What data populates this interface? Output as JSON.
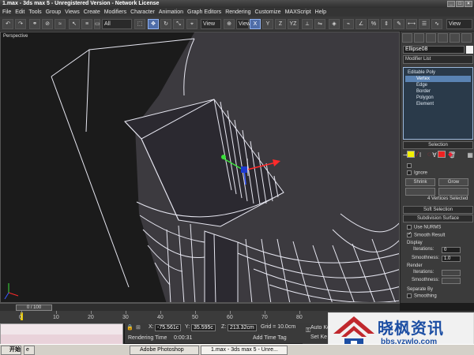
{
  "window": {
    "title": "1.max - 3ds max 5 - Unregistered Version - Network License",
    "controls": [
      "_",
      "□",
      "×"
    ]
  },
  "menu": [
    "File",
    "Edit",
    "Tools",
    "Group",
    "Views",
    "Create",
    "Modifiers",
    "Character",
    "Animation",
    "Graph Editors",
    "Rendering",
    "Customize",
    "MAXScript",
    "Help"
  ],
  "toolbar": {
    "selection_filter": "All",
    "refcoord_1": "View",
    "refcoord_2": "View",
    "axis_x": "X",
    "axis_y": "Y",
    "axis_z": "Z",
    "axis_yz": "YZ",
    "named_sets": "View"
  },
  "viewport": {
    "label": "Perspective",
    "wire_color": "#e6e6f0",
    "bg_color": "#1b1b1b",
    "fill_color": "#3c3a3f"
  },
  "command_panel": {
    "object_name": "Ellipse08",
    "modifier_list": "Modifier List",
    "stack": {
      "root": "Editable Poly",
      "items": [
        "Vertex",
        "Edge",
        "Border",
        "Polygon",
        "Element"
      ],
      "selected": "Vertex"
    },
    "selection": {
      "title": "Selection",
      "ignore": "Ignore",
      "shrink": "Shrink",
      "grow": "Grow",
      "status": "4 Vertices Selected"
    },
    "soft_selection": "Soft Selection",
    "subdivision": {
      "title": "Subdivision Surface",
      "use_nurms": "Use NURMS",
      "smooth_result": "Smooth Result",
      "display": "Display",
      "iterations_label": "Iterations:",
      "iterations": "0",
      "smoothness_label": "Smoothness:",
      "smoothness": "1.0",
      "render": "Render",
      "r_iterations_label": "Iterations:",
      "r_smoothness_label": "Smoothness:",
      "separate_by": "Separate By",
      "smoothing": "Smoothing",
      "materia": "Materia"
    }
  },
  "timeline": {
    "slider": "0 / 100",
    "ticks": [
      "0",
      "10",
      "20",
      "30",
      "40",
      "50",
      "60",
      "70",
      "80"
    ]
  },
  "status": {
    "x_label": "X:",
    "x": "-75.561c",
    "y_label": "Y:",
    "y": "35.595c",
    "z_label": "Z:",
    "z": "213.32cm",
    "grid": "Grid = 10.0cm",
    "rendering_time_label": "Rendering Time",
    "rendering_time": "0:00:31",
    "add_time_tag": "Add Time Tag",
    "auto_key": "Auto Ke",
    "set_key": "Set Ke"
  },
  "taskbar": {
    "start": "开始",
    "tasks": [
      "Adobe Photoshop",
      "1.max - 3ds max 5 - Unre..."
    ]
  },
  "watermark": {
    "title": "晓枫资讯",
    "url": "bbs.yzwlo.com"
  }
}
